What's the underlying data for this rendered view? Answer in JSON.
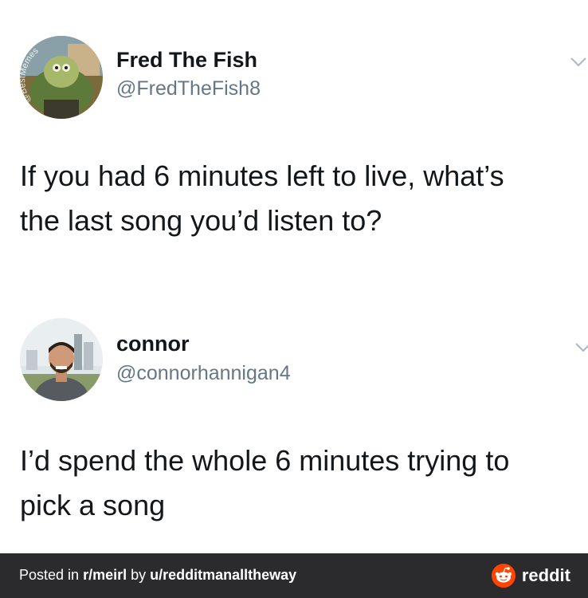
{
  "tweets": [
    {
      "name": "Fred The Fish",
      "handle": "@FredTheFish8",
      "text_line1": "If you had 6 minutes left to live, what’s",
      "text_line2": "the last song you’d listen to?",
      "avatar_watermark": "@BestMemes"
    },
    {
      "name": "connor",
      "handle": "@connorhannigan4",
      "text_line1": "I’d spend the whole 6 minutes trying to",
      "text_line2": "pick a song"
    }
  ],
  "footer": {
    "prefix": "Posted in ",
    "subreddit": "r/meirl",
    "by": " by ",
    "user": "u/redditmanalltheway",
    "brand": "reddit"
  },
  "colors": {
    "footer_bg": "#2b2b2d",
    "reddit_orange": "#ff4500",
    "handle_gray": "#657786"
  }
}
